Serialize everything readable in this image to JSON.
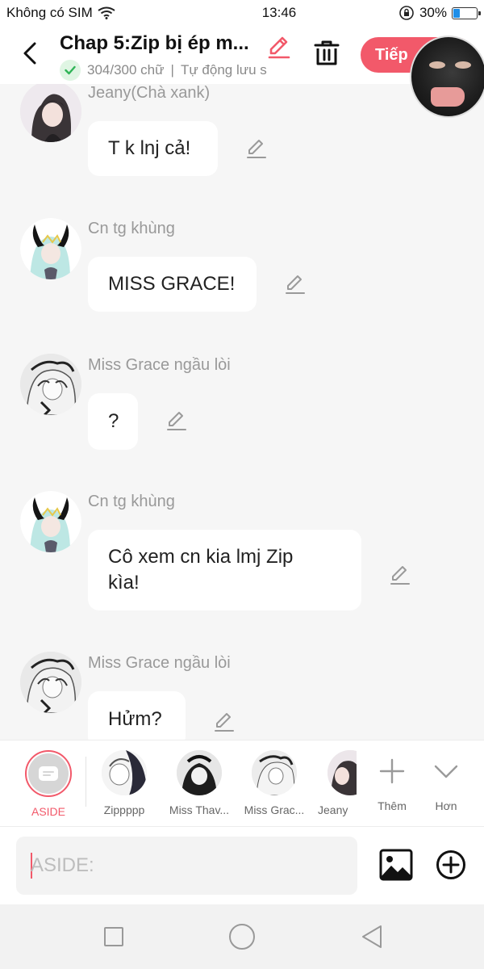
{
  "status": {
    "carrier": "Không có SIM",
    "time": "13:46",
    "battery": "30%",
    "battery_level": 0.3
  },
  "header": {
    "title": "Chap 5:Zip bị ép m...",
    "word_count": "304/300 chữ",
    "separator": "|",
    "autosave": "Tự động lưu s",
    "next_label": "Tiếp"
  },
  "messages": [
    {
      "sender": "Jeany(Chà xank)",
      "text": "T k lnj cả!"
    },
    {
      "sender": "Cn tg khùng",
      "text": "MISS GRACE!"
    },
    {
      "sender": "Miss Grace ngầu lòi",
      "text": "?"
    },
    {
      "sender": "Cn tg khùng",
      "text": "Cô xem cn kia lmj Zip kìa!"
    },
    {
      "sender": "Miss Grace ngầu lòi",
      "text": "Hửm?"
    }
  ],
  "characters": {
    "aside": "ASIDE",
    "items": [
      "Zippppp",
      "Miss Thav...",
      "Miss Grac...",
      "Jeany"
    ],
    "add_label": "Thêm",
    "more_label": "Hơn"
  },
  "input": {
    "placeholder": "ASIDE:"
  },
  "colors": {
    "accent": "#f2596a",
    "bubble": "#ffffff",
    "background": "#f6f6f6"
  }
}
